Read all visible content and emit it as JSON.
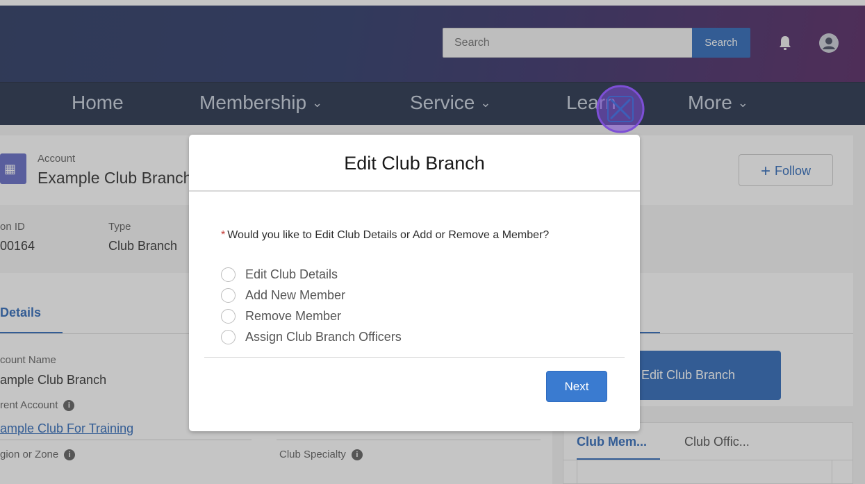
{
  "header": {
    "search_placeholder": "Search",
    "search_button": "Search",
    "icons": [
      "bell-icon",
      "user-avatar-icon"
    ]
  },
  "nav": {
    "home": "Home",
    "membership": "Membership",
    "service": "Service",
    "learn": "Learn",
    "more": "More",
    "chevron": "⌄"
  },
  "record": {
    "object_label": "Account",
    "name": "Example Club Branch",
    "follow_label": "Follow"
  },
  "highlights": {
    "id_label": "on ID",
    "id_value": "00164",
    "type_label": "Type",
    "type_value": "Club Branch"
  },
  "details": {
    "tab_label": "Details",
    "account_name_label": "count Name",
    "account_name_value": "ample Club Branch",
    "parent_account_label": "rent Account",
    "parent_account_value": "ample Club For Training",
    "region_label": "gion or Zone",
    "club_specialty_label": "Club Specialty",
    "info_glyph": "i"
  },
  "right_panel": {
    "tab_label": "...",
    "edit_button": "Edit Club Branch",
    "related_tab_1": "Club Mem...",
    "related_tab_2": "Club Offic..."
  },
  "modal": {
    "title": "Edit Club Branch",
    "required_marker": "*",
    "question": "Would you like to Edit Club Details or Add or Remove a Member?",
    "options": [
      "Edit Club Details",
      "Add New Member",
      "Remove Member",
      "Assign Club Branch Officers"
    ],
    "next_button": "Next"
  },
  "colors": {
    "brand_blue": "#1f5fb4",
    "nav_bg": "#16243f",
    "close_icon_accent": "#7d4fd6",
    "required_red": "#c23934"
  }
}
